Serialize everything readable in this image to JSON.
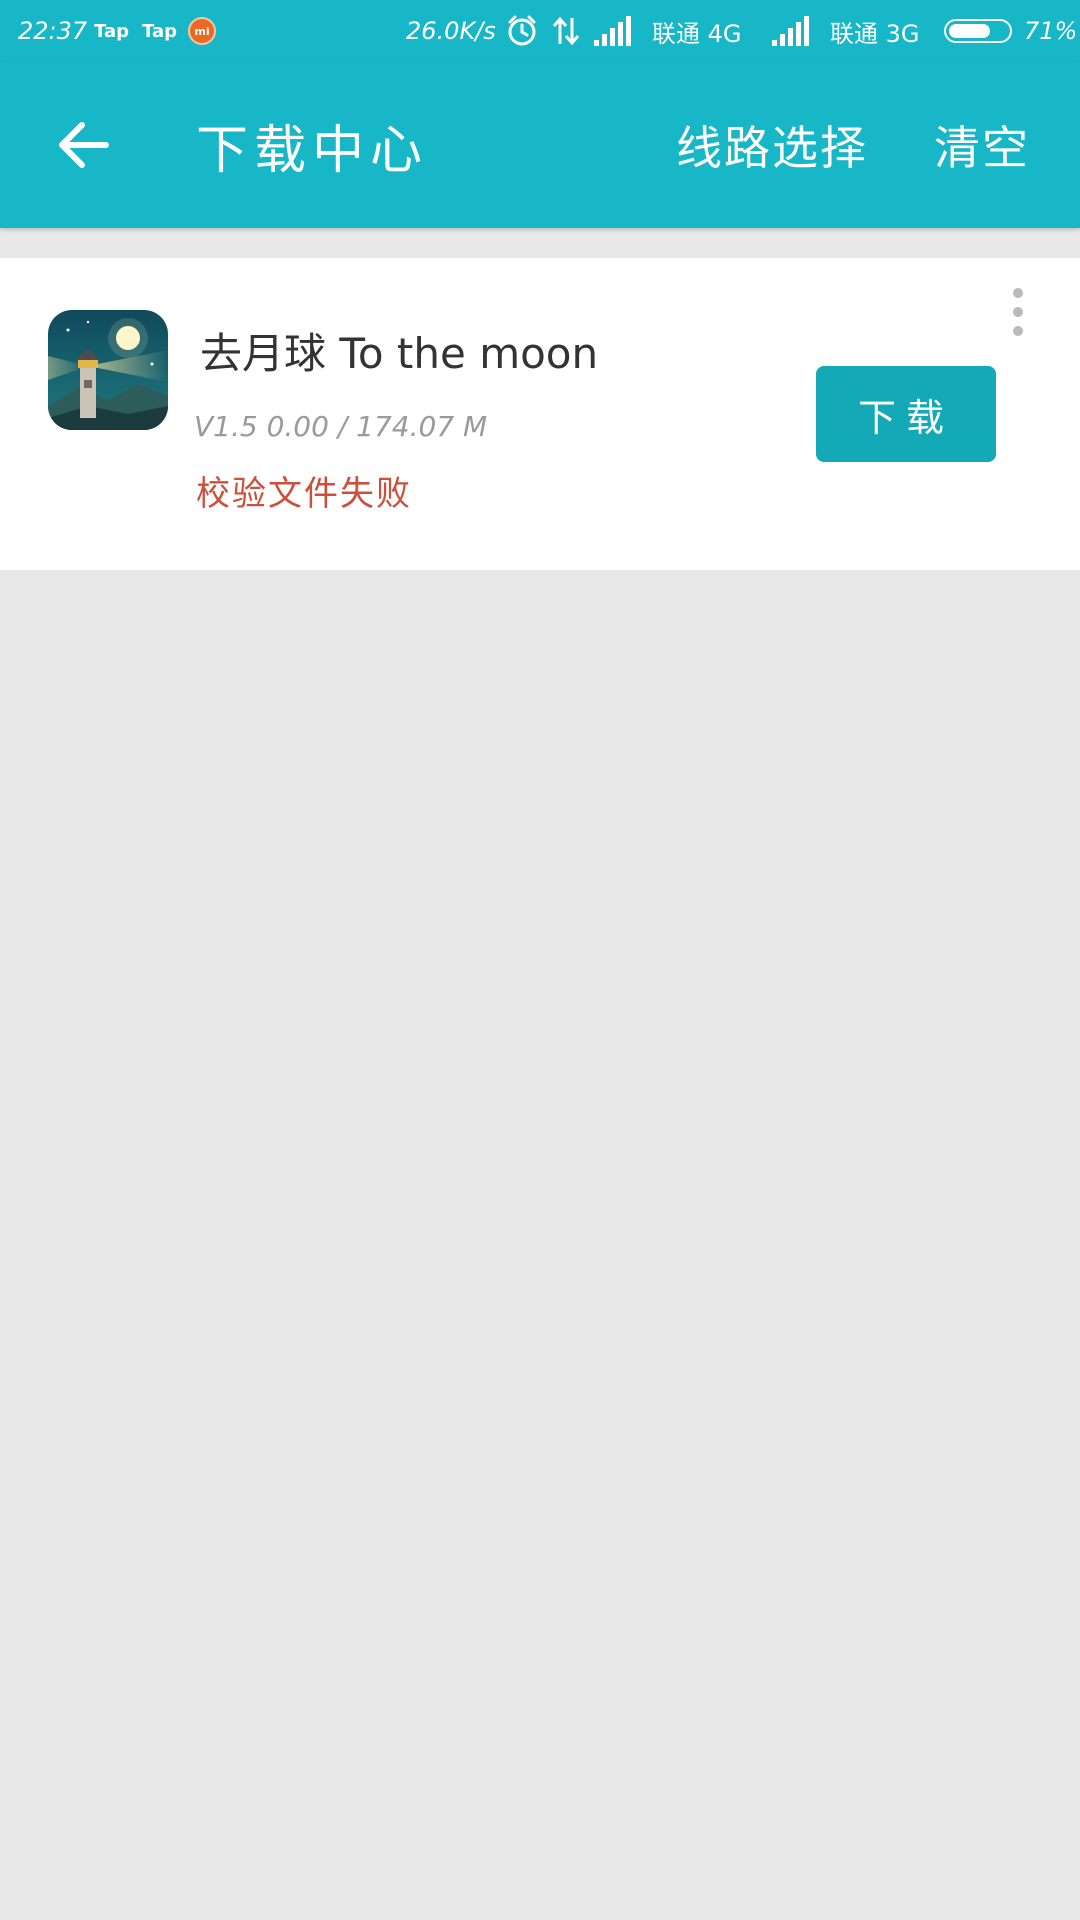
{
  "status_bar": {
    "time": "22:37",
    "notif_app_1": "Tap",
    "notif_app_2": "Tap",
    "notif_badge": "mi",
    "net_speed": "26.0K/s",
    "carrier_1": "联通 4G",
    "carrier_2": "联通 3G",
    "battery_percent": "71%",
    "battery_level": 0.71,
    "icons": [
      "alarm-icon",
      "data-transfer-icon",
      "signal-icon",
      "signal-icon",
      "battery-icon"
    ]
  },
  "appbar": {
    "title": "下载中心",
    "action_route": "线路选择",
    "action_clear": "清空",
    "back_icon": "arrow-left-icon"
  },
  "download_item": {
    "name": "去月球 To the moon",
    "meta": "V1.5 0.00 / 174.07 M",
    "error": "校验文件失败",
    "button_label": "下载",
    "more_icon": "more-vertical-icon"
  },
  "colors": {
    "primary": "#17b7c8",
    "button": "#13a9b7",
    "error": "#cc4f3c",
    "background": "#e8e8e8"
  }
}
